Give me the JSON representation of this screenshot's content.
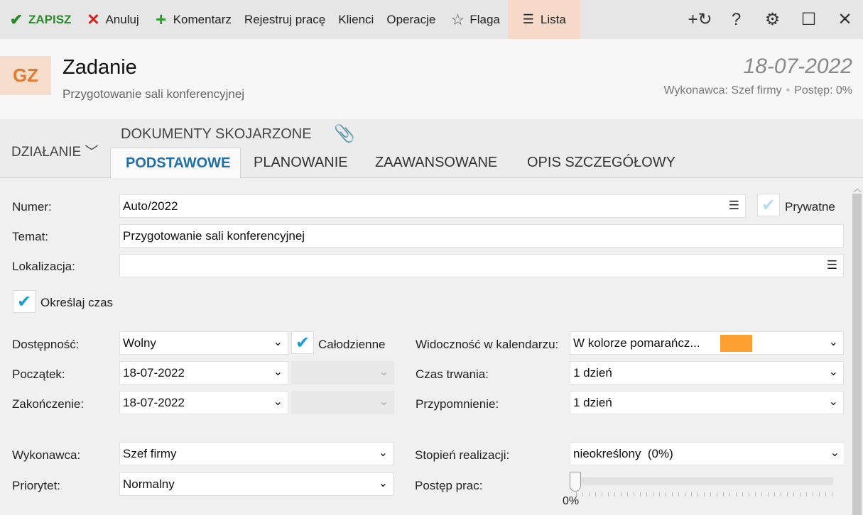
{
  "toolbar": {
    "save": "ZAPISZ",
    "cancel": "Anuluj",
    "comment": "Komentarz",
    "register_work": "Rejestruj pracę",
    "clients": "Klienci",
    "operations": "Operacje",
    "flag": "Flaga",
    "list": "Lista",
    "icons": {
      "add_related": "+↻",
      "help": "?",
      "settings": "⚙",
      "maximize": "☐",
      "close": "✕"
    }
  },
  "header": {
    "badge": "GZ",
    "title": "Zadanie",
    "subtitle": "Przygotowanie sali konferencyjnej",
    "date": "18-07-2022",
    "assignee": "Wykonawca: Szef firmy",
    "progress": "Postęp: 0%"
  },
  "tabs": {
    "action": "DZIAŁANIE",
    "linked_docs": "DOKUMENTY SKOJARZONE",
    "items": [
      "PODSTAWOWE",
      "PLANOWANIE",
      "ZAAWANSOWANE",
      "OPIS SZCZEGÓŁOWY"
    ],
    "active": "PODSTAWOWE"
  },
  "form": {
    "number": {
      "label": "Numer:",
      "value": "Auto/2022"
    },
    "private": {
      "label": "Prywatne",
      "checked": false
    },
    "subject": {
      "label": "Temat:",
      "value": "Przygotowanie sali konferencyjnej"
    },
    "location": {
      "label": "Lokalizacja:",
      "value": ""
    },
    "specify_time": {
      "label": "Określaj czas",
      "checked": true
    },
    "availability": {
      "label": "Dostępność:",
      "value": "Wolny"
    },
    "all_day": {
      "label": "Całodzienne",
      "checked": true
    },
    "start": {
      "label": "Początek:",
      "date": "18-07-2022",
      "time": ""
    },
    "end": {
      "label": "Zakończenie:",
      "date": "18-07-2022",
      "time": ""
    },
    "calendar_visibility": {
      "label": "Widoczność w kalendarzu:",
      "value": "W kolorze pomarańcz...",
      "color": "#ffa030"
    },
    "duration": {
      "label": "Czas trwania:",
      "value": "1 dzień"
    },
    "reminder": {
      "label": "Przypomnienie:",
      "value": "1 dzień"
    },
    "assignee": {
      "label": "Wykonawca:",
      "value": "Szef firmy"
    },
    "priority": {
      "label": "Priorytet:",
      "value": "Normalny"
    },
    "completion": {
      "label": "Stopień realizacji:",
      "value": "nieokreślony  (0%)"
    },
    "work_progress": {
      "label": "Postęp prac:",
      "value": "0%",
      "fraction": 0
    }
  }
}
